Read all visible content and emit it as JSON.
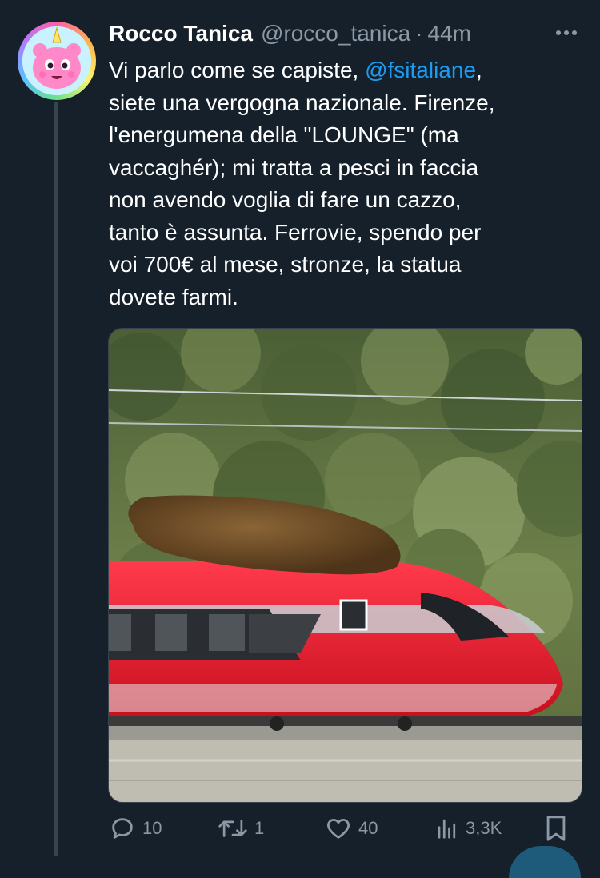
{
  "tweet": {
    "author_name": "Rocco Tanica",
    "handle": "@rocco_tanica",
    "separator": "·",
    "time": "44m",
    "text_before_mention": "Vi parlo come se capiste, ",
    "mention": "@fsitaliane",
    "text_after_mention": ",\nsiete una vergogna nazionale. Firenze,\nl'energumena della \"LOUNGE\" (ma\nvaccaghér); mi tratta a pesci in faccia\nnon avendo voglia di fare un cazzo,\ntanto è assunta. Ferrovie, spendo per\nvoi 700€ al mese, stronze, la statua\ndovete farmi.",
    "media_description": "photo",
    "stats": {
      "replies": "10",
      "retweets": "1",
      "likes": "40",
      "views": "3,3K"
    }
  },
  "icons": {
    "more": "more-icon",
    "reply": "reply-icon",
    "retweet": "retweet-icon",
    "like": "heart-icon",
    "views": "views-icon",
    "bookmark": "bookmark-icon"
  },
  "colors": {
    "background": "#15202b",
    "accent": "#1d9bf0",
    "secondary_text": "#8b98a5",
    "train_red": "#e3172e"
  }
}
